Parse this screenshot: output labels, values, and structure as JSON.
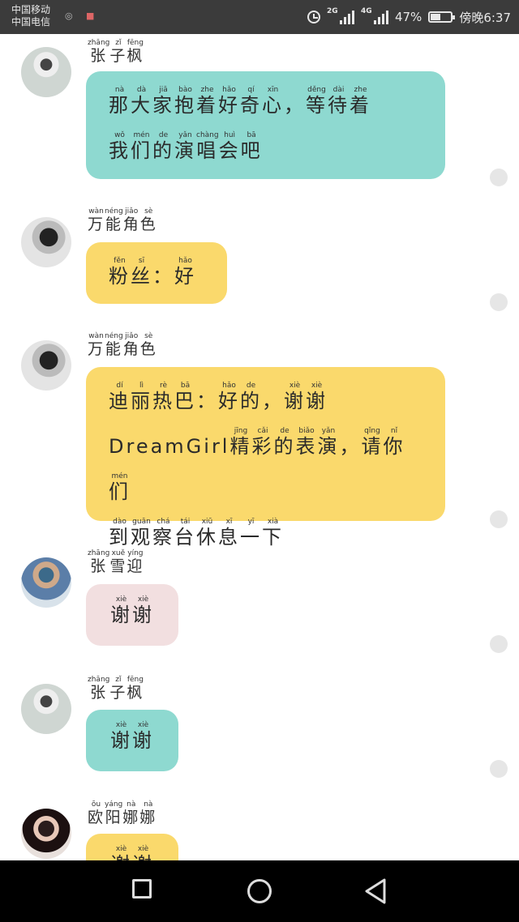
{
  "status_bar": {
    "carrier1": "中国移动",
    "carrier2": "中国电信",
    "network1": "2G",
    "network2": "4G",
    "battery": "47%",
    "battery_level": 0.47,
    "time": "傍晚6:37"
  },
  "messages": [
    {
      "sender": [
        [
          "张",
          "zhāng"
        ],
        [
          "子",
          "zǐ"
        ],
        [
          "枫",
          "fēng"
        ]
      ],
      "color": "teal",
      "lines": [
        [
          [
            "那",
            "nà"
          ],
          [
            "大",
            "dà"
          ],
          [
            "家",
            "jiā"
          ],
          [
            "抱",
            "bào"
          ],
          [
            "着",
            "zhe"
          ],
          [
            "好",
            "hǎo"
          ],
          [
            "奇",
            "qí"
          ],
          [
            "心",
            "xīn"
          ],
          [
            "，",
            ""
          ],
          [
            "等",
            "děng"
          ],
          [
            "待",
            "dài"
          ],
          [
            "着",
            "zhe"
          ]
        ],
        [
          [
            "我",
            "wǒ"
          ],
          [
            "们",
            "mén"
          ],
          [
            "的",
            "de"
          ],
          [
            "演",
            "yǎn"
          ],
          [
            "唱",
            "chàng"
          ],
          [
            "会",
            "huì"
          ],
          [
            "吧",
            "bā"
          ]
        ]
      ]
    },
    {
      "sender": [
        [
          "万",
          "wàn"
        ],
        [
          "能",
          "néng"
        ],
        [
          "角",
          "jiǎo"
        ],
        [
          "色",
          "sè"
        ]
      ],
      "color": "yellow",
      "lines": [
        [
          [
            "粉",
            "fěn"
          ],
          [
            "丝",
            "sī"
          ],
          [
            "：",
            ""
          ],
          [
            "好",
            "hǎo"
          ]
        ]
      ]
    },
    {
      "sender": [
        [
          "万",
          "wàn"
        ],
        [
          "能",
          "néng"
        ],
        [
          "角",
          "jiǎo"
        ],
        [
          "色",
          "sè"
        ]
      ],
      "color": "yellow",
      "lines": [
        [
          [
            "迪",
            "dí"
          ],
          [
            "丽",
            "lì"
          ],
          [
            "热",
            "rè"
          ],
          [
            "巴",
            "bā"
          ],
          [
            "：",
            ""
          ],
          [
            "好",
            "hǎo"
          ],
          [
            "的",
            "de"
          ],
          [
            "，",
            ""
          ],
          [
            "谢",
            "xiè"
          ],
          [
            "谢",
            "xiè"
          ]
        ],
        [
          [
            "DreamGirl",
            ""
          ],
          [
            "精",
            "jīng"
          ],
          [
            "彩",
            "cǎi"
          ],
          [
            "的",
            "de"
          ],
          [
            "表",
            "biǎo"
          ],
          [
            "演",
            "yǎn"
          ],
          [
            "，",
            ""
          ],
          [
            "请",
            "qǐng"
          ],
          [
            "你",
            "nǐ"
          ],
          [
            "们",
            "mén"
          ]
        ],
        [
          [
            "到",
            "dào"
          ],
          [
            "观",
            "guān"
          ],
          [
            "察",
            "chá"
          ],
          [
            "台",
            "tái"
          ],
          [
            "休",
            "xiū"
          ],
          [
            "息",
            "xī"
          ],
          [
            "一",
            "yī"
          ],
          [
            "下",
            "xià"
          ]
        ]
      ]
    },
    {
      "sender": [
        [
          "张",
          "zhāng"
        ],
        [
          "雪",
          "xuě"
        ],
        [
          "迎",
          "yíng"
        ]
      ],
      "color": "pink",
      "lines": [
        [
          [
            "谢",
            "xiè"
          ],
          [
            "谢",
            "xiè"
          ]
        ]
      ]
    },
    {
      "sender": [
        [
          "张",
          "zhāng"
        ],
        [
          "子",
          "zǐ"
        ],
        [
          "枫",
          "fēng"
        ]
      ],
      "color": "teal",
      "lines": [
        [
          [
            "谢",
            "xiè"
          ],
          [
            "谢",
            "xiè"
          ]
        ]
      ]
    },
    {
      "sender": [
        [
          "欧",
          "ōu"
        ],
        [
          "阳",
          "yáng"
        ],
        [
          "娜",
          "nà"
        ],
        [
          "娜",
          "nà"
        ]
      ],
      "color": "yellow",
      "lines": [
        [
          [
            "谢",
            "xiè"
          ],
          [
            "谢",
            "xiè"
          ]
        ]
      ]
    }
  ],
  "nav": {
    "icons": [
      "recent-apps-icon",
      "home-icon",
      "back-icon"
    ]
  }
}
